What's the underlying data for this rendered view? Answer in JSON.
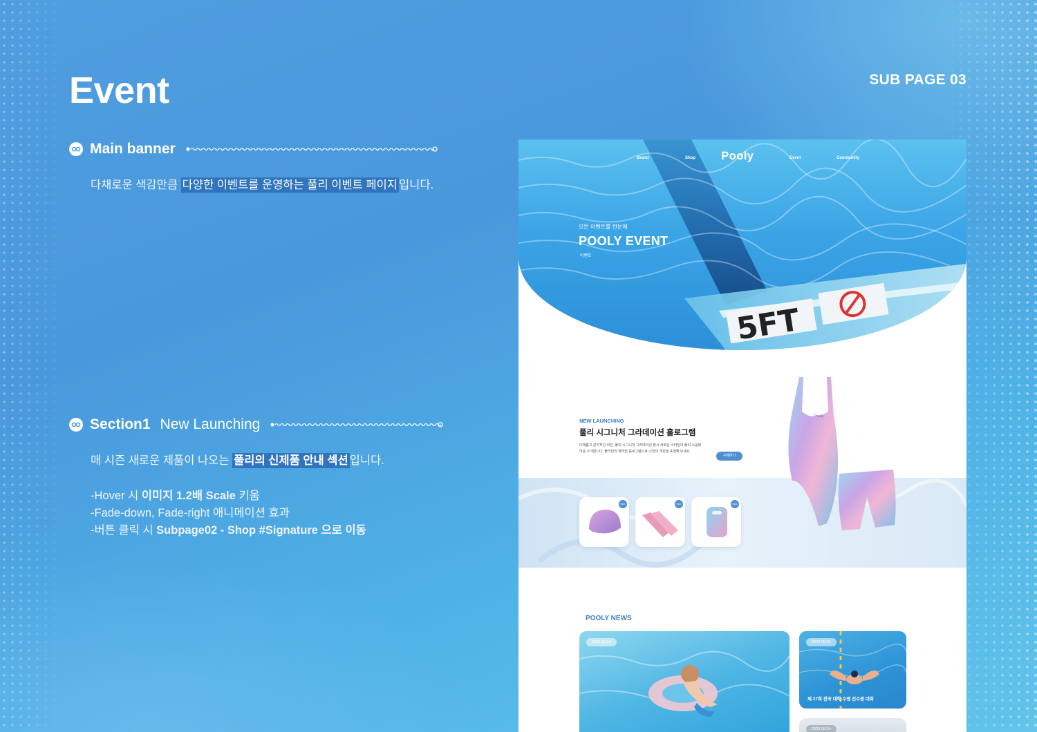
{
  "page": {
    "title": "Event",
    "sub_page": "SUB PAGE 03"
  },
  "sections": {
    "main_banner": {
      "title": "Main banner",
      "desc_plain1": "다채로운 색감만큼 ",
      "desc_highlight": "다양한 이벤트를 운영하는 풀리 이벤트 페이지",
      "desc_plain2": "입니다."
    },
    "section1": {
      "title_a": "Section1",
      "title_b": "New Launching",
      "desc_plain1": "매 시즌 새로운 제품이 나오는 ",
      "desc_highlight": "풀리의 신제품 안내 섹션",
      "desc_plain2": "입니다.",
      "bullets": [
        {
          "pre": "-Hover 시 ",
          "bold": "이미지 1.2배 Scale",
          "post": " 키움"
        },
        {
          "pre": "-Fade-down, Fade-right 애니메이션 효과",
          "bold": "",
          "post": ""
        },
        {
          "pre": "-버튼 클릭 시 ",
          "bold": "Subpage02 - Shop #Signature 으로 이동",
          "post": ""
        }
      ]
    }
  },
  "mockup": {
    "nav": {
      "brand": "Brand",
      "shop": "Shop",
      "logo": "Pooly",
      "event": "Event",
      "community": "Community"
    },
    "hero": {
      "small": "모든 이벤트를 한눈에",
      "big": "POOLY EVENT",
      "sub": "이벤트",
      "sign": "5FT"
    },
    "launch": {
      "tag": "NEW LAUNCHING",
      "title": "풀리 시그니처 그라데이션 홀로그램",
      "body": "다채롭고 감각적인 라인, 풀리 시그니처 그라데이션 출시 새로운 스타일의 풀리 스윔웨어를 소개합니다. 풀리만의 화려한 홀로그램으로 나만의 개성을 표현해 보세요.",
      "button": "구매하기",
      "badge": "New",
      "swimsuit_logo": "Pooly"
    },
    "news": {
      "title": "POOLY NEWS",
      "items": [
        {
          "date": "2023.03.14",
          "caption": ""
        },
        {
          "date": "2023.05.30",
          "caption": "제 27회 전국 대학 수영 선수권 대회"
        },
        {
          "date": "2023.06.24",
          "caption": ""
        }
      ]
    }
  },
  "colors": {
    "accent": "#3b7fc7",
    "highlight": "#2f74bd",
    "background": "#4a98dc"
  }
}
